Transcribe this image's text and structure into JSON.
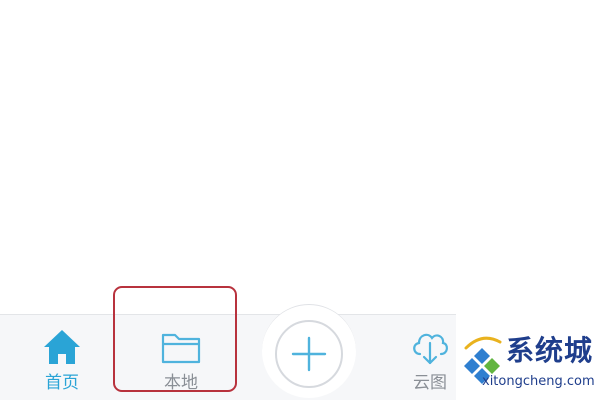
{
  "tabbar": {
    "home": {
      "label": "首页",
      "icon": "home-icon",
      "active": true
    },
    "local": {
      "label": "本地",
      "icon": "folder-icon"
    },
    "add": {
      "icon": "plus-icon"
    },
    "cloud": {
      "label": "云图",
      "icon": "cloud-download-icon"
    }
  },
  "watermark": {
    "brand": "系统城",
    "domain": "xitongcheng.com"
  },
  "colors": {
    "accent": "#2aa4d6",
    "inactive_text": "#8a8f96",
    "highlight_box": "#b8323d",
    "tabbar_bg": "#f6f7f9",
    "watermark_blue": "#1f3e8c"
  }
}
